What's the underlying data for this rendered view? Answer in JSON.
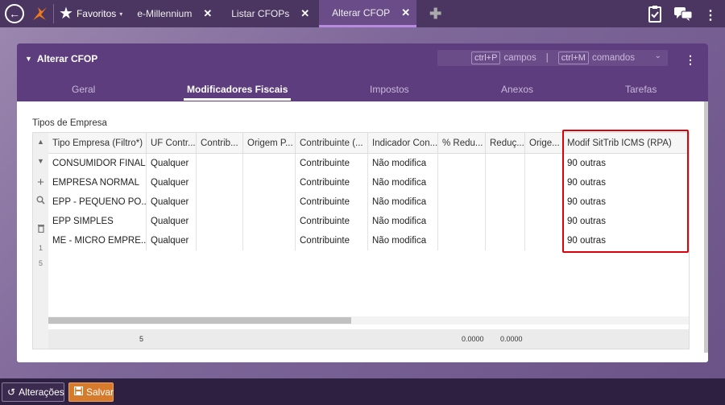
{
  "topbar": {
    "favorites_label": "Favoritos",
    "tabs": [
      {
        "label": "e-Millennium"
      },
      {
        "label": "Listar CFOPs"
      },
      {
        "label": "Alterar CFOP"
      }
    ]
  },
  "window": {
    "title": "Alterar CFOP",
    "shortcuts": {
      "key1": "ctrl+P",
      "label1": "campos",
      "key2": "ctrl+M",
      "label2": "comandos"
    },
    "tabs": [
      "Geral",
      "Modificadores Fiscais",
      "Impostos",
      "Anexos",
      "Tarefas"
    ],
    "active_tab": "Modificadores Fiscais"
  },
  "section_label": "Tipos de Empresa",
  "grid": {
    "columns": [
      "Tipo Empresa (Filtro*)",
      "UF Contr...",
      "Contrib...",
      "Origem P...",
      "Contribuinte (...",
      "Indicador Con...",
      "% Redu...",
      "Reduç...",
      "Orige...",
      "Modif SitTrib ICMS (RPA)"
    ],
    "rows": [
      [
        "CONSUMIDOR FINAL",
        "Qualquer",
        "",
        "",
        "Contribuinte",
        "Não modifica",
        "",
        "",
        "",
        "90 outras"
      ],
      [
        "EMPRESA NORMAL",
        "Qualquer",
        "",
        "",
        "Contribuinte",
        "Não modifica",
        "",
        "",
        "",
        "90 outras"
      ],
      [
        "EPP - PEQUENO PO...",
        "Qualquer",
        "",
        "",
        "Contribuinte",
        "Não modifica",
        "",
        "",
        "",
        "90 outras"
      ],
      [
        "EPP SIMPLES",
        "Qualquer",
        "",
        "",
        "Contribuinte",
        "Não modifica",
        "",
        "",
        "",
        "90 outras"
      ],
      [
        "ME - MICRO EMPRE...",
        "Qualquer",
        "",
        "",
        "Contribuinte",
        "Não modifica",
        "",
        "",
        "",
        "90 outras"
      ]
    ],
    "page_numbers": [
      "1",
      "5"
    ],
    "footer": {
      "count": "5",
      "reduction_total": "0.0000",
      "reduction2_total": "0.0000"
    }
  },
  "bottom": {
    "changes_label": "Alterações",
    "save_label": "Salvar"
  },
  "colors": {
    "header_purple": "#5d3d7d",
    "topbar": "#4b3561",
    "save_orange": "#d57b2b",
    "highlight_red": "#e0000a"
  }
}
